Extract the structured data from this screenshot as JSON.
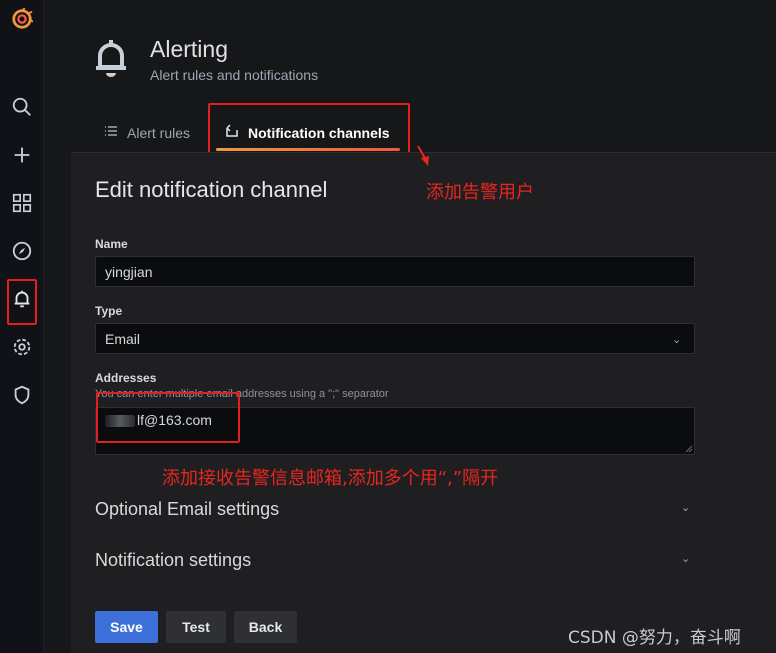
{
  "colors": {
    "accent": "#3d71d9",
    "annotation": "#e8261f",
    "brand": "#f2983a"
  },
  "sidebar": {
    "items": [
      {
        "icon": "grafana-logo-icon"
      },
      {
        "icon": "search-icon"
      },
      {
        "icon": "plus-icon"
      },
      {
        "icon": "dashboards-icon"
      },
      {
        "icon": "explore-icon"
      },
      {
        "icon": "alert-bell-icon",
        "active": true
      },
      {
        "icon": "gear-icon"
      },
      {
        "icon": "shield-icon"
      }
    ]
  },
  "header": {
    "icon": "alert-bell-icon",
    "title": "Alerting",
    "subtitle": "Alert rules and notifications"
  },
  "tabs": [
    {
      "label": "Alert rules",
      "icon": "list-icon",
      "active": false
    },
    {
      "label": "Notification channels",
      "icon": "channel-icon",
      "active": true
    }
  ],
  "form": {
    "title": "Edit notification channel",
    "name_label": "Name",
    "name_value": "yingjian",
    "type_label": "Type",
    "type_value": "Email",
    "addresses_label": "Addresses",
    "addresses_description": "You can enter multiple email addresses using a \";\" separator",
    "addresses_value_suffix": "lf@163.com",
    "optional_section": "Optional Email settings",
    "notification_section": "Notification settings",
    "save_label": "Save",
    "test_label": "Test",
    "back_label": "Back"
  },
  "annotations": {
    "tab_note": "添加告警用户",
    "address_note": "添加接收告警信息邮箱,添加多个用“,”隔开"
  },
  "watermark": "CSDN @努力，奋斗啊"
}
